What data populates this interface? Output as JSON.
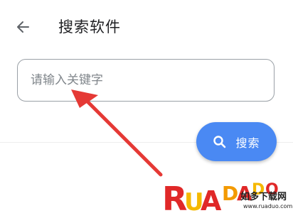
{
  "header": {
    "title": "搜索软件",
    "back_icon": "arrow-left-icon"
  },
  "search": {
    "placeholder": "请输入关键字",
    "value": ""
  },
  "search_button": {
    "label": "搜索",
    "icon": "search-icon",
    "color": "#4a89f3"
  },
  "annotation": {
    "arrow_color": "#e53935"
  },
  "watermark": {
    "logo_text": "RUADADO",
    "cn_text": "如多下载网",
    "url_text": "www.ruaduo.com"
  }
}
